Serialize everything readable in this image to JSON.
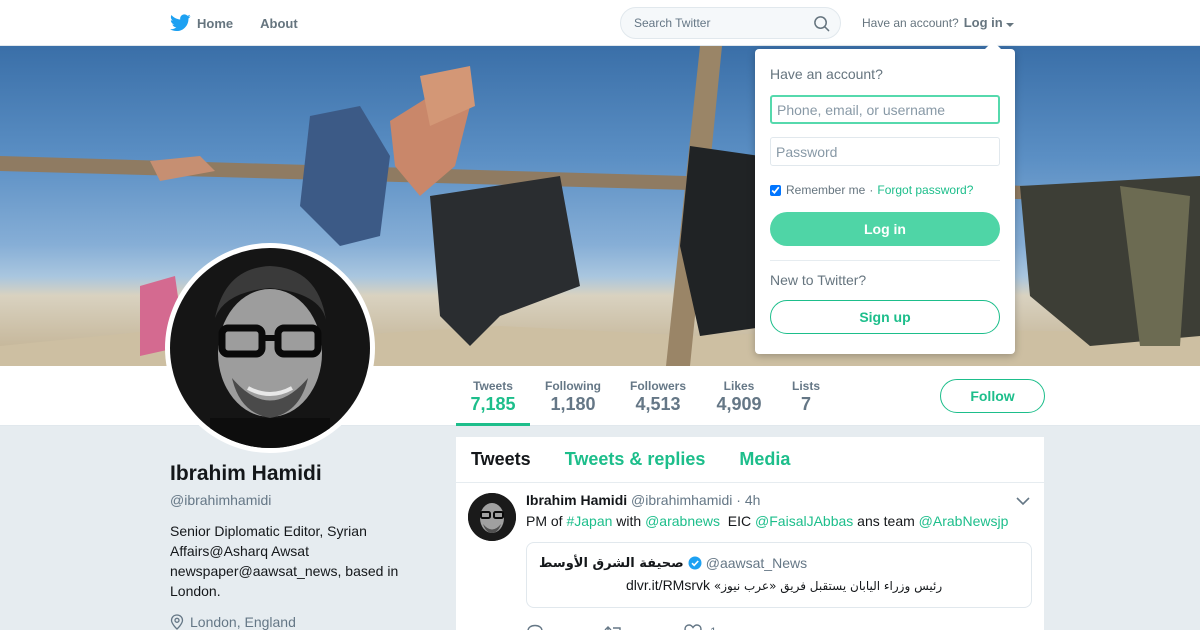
{
  "nav": {
    "home_label": "Home",
    "about_label": "About",
    "search_placeholder": "Search Twitter",
    "account_prompt": "Have an account?",
    "login_label": "Log in"
  },
  "brand": {
    "accent": "#1dbe8b",
    "logo_icon": "twitter-bird-icon",
    "bird_color": "#1da1f2"
  },
  "profile": {
    "name": "Ibrahim Hamidi",
    "handle": "@ibrahimhamidi",
    "bio": "Senior Diplomatic Editor, Syrian Affairs@Asharq Awsat newspaper@aawsat_news, based in London.",
    "location": "London, England",
    "follow_label": "Follow"
  },
  "stats": [
    {
      "label": "Tweets",
      "value": "7,185"
    },
    {
      "label": "Following",
      "value": "1,180"
    },
    {
      "label": "Followers",
      "value": "4,513"
    },
    {
      "label": "Likes",
      "value": "4,909"
    },
    {
      "label": "Lists",
      "value": "7"
    }
  ],
  "timeline": {
    "tabs": [
      "Tweets",
      "Tweets & replies",
      "Media"
    ],
    "tweet": {
      "author_name": "Ibrahim Hamidi",
      "author_handle": "@ibrahimhamidi",
      "time": "· 4h",
      "text_parts": [
        "PM of ",
        "#Japan",
        " with ",
        "@arabnews",
        "  EIC ",
        "@FaisalJAbbas",
        " ans team ",
        "@ArabNewsjp"
      ],
      "quote": {
        "name": "صحيفة الشرق الأوسط",
        "handle": "@aawsat_News",
        "link": "dlvr.it/RMsrvk",
        "text": "رئيس وزراء اليابان يستقبل فريق «عرب نيوز»"
      },
      "likes": "1"
    }
  },
  "login": {
    "title": "Have an account?",
    "username_placeholder": "Phone, email, or username",
    "password_placeholder": "Password",
    "remember_label": "Remember me",
    "separator": "·",
    "forgot_label": "Forgot password?",
    "login_button": "Log in",
    "new_prompt": "New to Twitter?",
    "signup_button": "Sign up"
  }
}
